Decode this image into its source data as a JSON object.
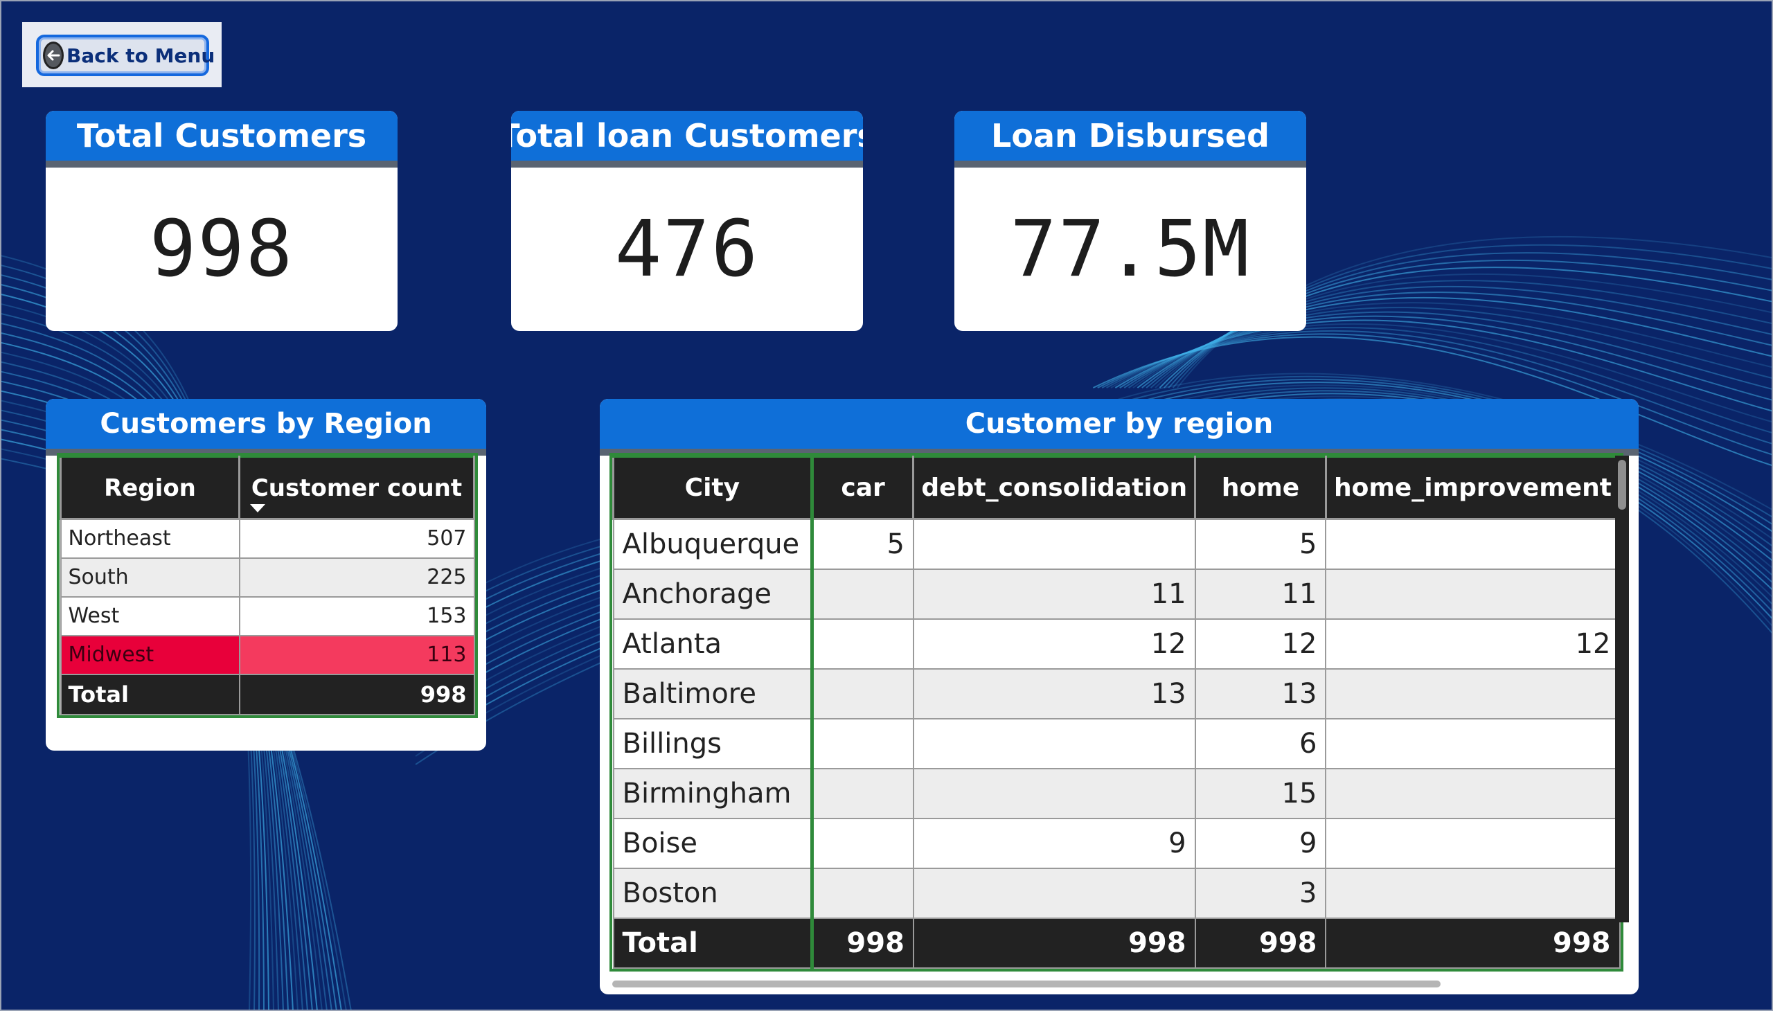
{
  "nav": {
    "back_label": "Back to Menu"
  },
  "kpis": [
    {
      "title": "Total Customers",
      "value": "998"
    },
    {
      "title": "Total loan Customers",
      "value": "476"
    },
    {
      "title": "Loan Disbursed",
      "value": "77.5M"
    }
  ],
  "region_panel": {
    "title": "Customers by Region",
    "columns": [
      "Region",
      "Customer count"
    ],
    "rows": [
      {
        "region": "Northeast",
        "count": "507"
      },
      {
        "region": "South",
        "count": "225"
      },
      {
        "region": "West",
        "count": "153"
      },
      {
        "region": "Midwest",
        "count": "113"
      }
    ],
    "total": {
      "label": "Total",
      "count": "998"
    }
  },
  "city_panel": {
    "title": "Customer by region",
    "columns": [
      "City",
      "car",
      "debt_consolidation",
      "home",
      "home_improvement"
    ],
    "rows": [
      [
        "Albuquerque",
        "5",
        "",
        "5",
        ""
      ],
      [
        "Anchorage",
        "",
        "11",
        "11",
        ""
      ],
      [
        "Atlanta",
        "",
        "12",
        "12",
        "12"
      ],
      [
        "Baltimore",
        "",
        "13",
        "13",
        ""
      ],
      [
        "Billings",
        "",
        "",
        "6",
        ""
      ],
      [
        "Birmingham",
        "",
        "",
        "15",
        ""
      ],
      [
        "Boise",
        "",
        "9",
        "9",
        ""
      ],
      [
        "Boston",
        "",
        "",
        "3",
        ""
      ]
    ],
    "total": [
      "Total",
      "998",
      "998",
      "998",
      "998"
    ]
  },
  "colors": {
    "background": "#0a2468",
    "header_blue": "#0f6fd8",
    "wave": "#3fb0e8",
    "highlight": "#e8003a"
  }
}
